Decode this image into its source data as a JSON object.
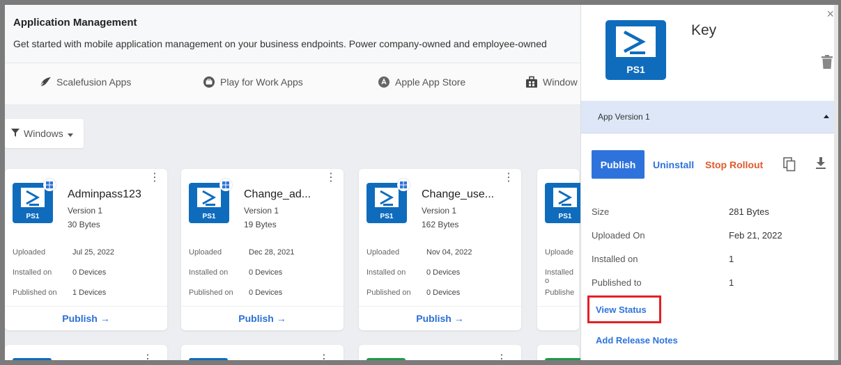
{
  "header": {
    "title": "Application Management",
    "subtitle": "Get started with mobile application management on your business endpoints. Power company-owned and employee-owned"
  },
  "tabs": [
    {
      "label": "Scalefusion Apps",
      "icon": "scalefusion-icon"
    },
    {
      "label": "Play for Work Apps",
      "icon": "briefcase-icon"
    },
    {
      "label": "Apple App Store",
      "icon": "app-store-icon"
    },
    {
      "label": "Window",
      "icon": "windows-store-icon"
    }
  ],
  "filter": {
    "label": "Windows",
    "icon": "filter-icon"
  },
  "cards": [
    {
      "name": "Adminpass123",
      "version": "Version 1",
      "size": "30 Bytes",
      "uploaded_label": "Uploaded",
      "uploaded": "Jul 25, 2022",
      "installed_label": "Installed on",
      "installed": "0 Devices",
      "published_label": "Published on",
      "published": "1 Devices",
      "publish_label": "Publish →"
    },
    {
      "name": "Change_ad...",
      "version": "Version 1",
      "size": "19 Bytes",
      "uploaded_label": "Uploaded",
      "uploaded": "Dec 28, 2021",
      "installed_label": "Installed on",
      "installed": "0 Devices",
      "published_label": "Published on",
      "published": "0 Devices",
      "publish_label": "Publish →"
    },
    {
      "name": "Change_use...",
      "version": "Version 1",
      "size": "162 Bytes",
      "uploaded_label": "Uploaded",
      "uploaded": "Nov 04, 2022",
      "installed_label": "Installed on",
      "installed": "0 Devices",
      "published_label": "Published on",
      "published": "0 Devices",
      "publish_label": "Publish →"
    },
    {
      "uploaded_label": "Uploade",
      "installed_label": "Installed o",
      "published_label": "Publishe"
    }
  ],
  "ps1_label": "PS1",
  "panel": {
    "app_name": "Key",
    "version_bar": "App Version 1",
    "publish": "Publish",
    "uninstall": "Uninstall",
    "stop_rollout": "Stop Rollout",
    "details": [
      {
        "key": "Size",
        "value": "281 Bytes"
      },
      {
        "key": "Uploaded On",
        "value": "Feb 21, 2022"
      },
      {
        "key": "Installed on",
        "value": "1"
      },
      {
        "key": "Published to",
        "value": "1"
      }
    ],
    "view_status": "View Status",
    "add_release_notes": "Add Release Notes",
    "close": "×"
  },
  "colors": {
    "accent": "#2e73dc",
    "ps1_blue": "#0f6cbd",
    "stop": "#e05a2c",
    "highlight": "#e32025"
  }
}
